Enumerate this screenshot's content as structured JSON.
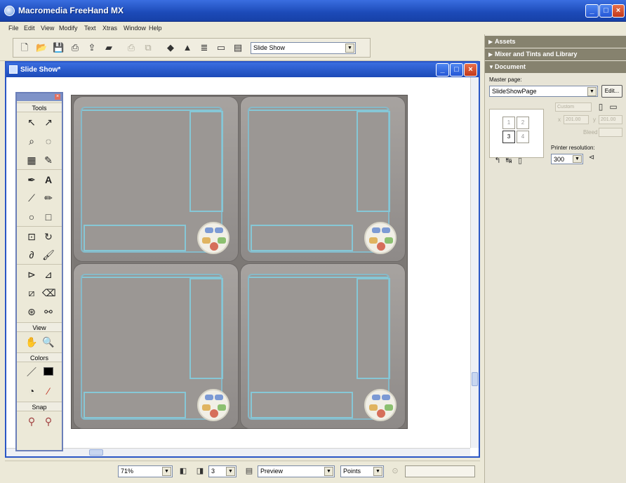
{
  "app": {
    "title": "Macromedia FreeHand MX"
  },
  "window_buttons": {
    "minimize": "_",
    "maximize": "□",
    "close": "×"
  },
  "menu": [
    "File",
    "Edit",
    "View",
    "Modify",
    "Text",
    "Xtras",
    "Window",
    "Help"
  ],
  "toolbar": {
    "icons": [
      "new-icon",
      "open-icon",
      "save-icon",
      "import-icon",
      "export-icon",
      "publish-icon",
      "print-icon",
      "clone-icon",
      "align-icon",
      "transform-icon",
      "text-editor-icon",
      "library-icon",
      "swf-icon"
    ],
    "document_combo": "Slide Show"
  },
  "document": {
    "title": "Slide Show*"
  },
  "tools_panel": {
    "sections": {
      "tools": "Tools",
      "view": "View",
      "colors": "Colors",
      "snap": "Snap"
    }
  },
  "status_bar": {
    "zoom": "71%",
    "page_number": "3",
    "preview_mode": "Preview",
    "units": "Points"
  },
  "right_panel": {
    "assets_header": "Assets",
    "mixer_header": "Mixer and Tints and Library",
    "document_header": "Document",
    "master_page_label": "Master page:",
    "master_page_value": "SlideShowPage",
    "edit_button": "Edit...",
    "orientation_select": "Custom",
    "x_value": "201.00",
    "y_value": "201.00",
    "bleed_label": "Bleed",
    "printer_resolution_label": "Printer resolution:",
    "printer_resolution_value": "300",
    "thumbnail_pages": [
      "1",
      "2",
      "3",
      "4"
    ]
  }
}
